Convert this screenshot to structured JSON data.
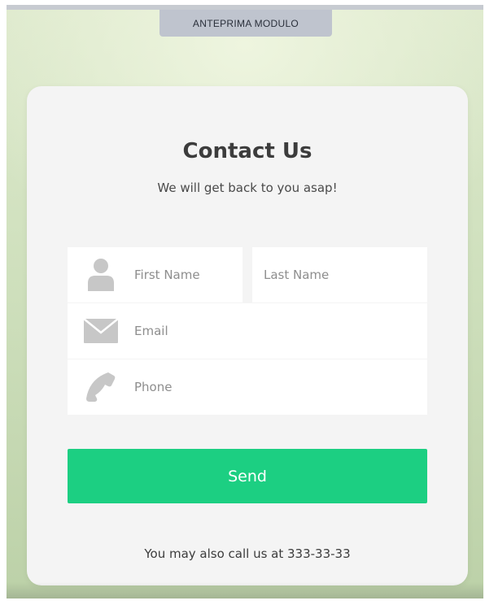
{
  "preview_tab": {
    "label": "ANTEPRIMA MODULO"
  },
  "card": {
    "title": "Contact Us",
    "subtitle": "We will get back to you asap!"
  },
  "form": {
    "first_name": {
      "placeholder": "First Name",
      "icon": "person-icon"
    },
    "last_name": {
      "placeholder": "Last Name"
    },
    "email": {
      "placeholder": "Email",
      "icon": "envelope-icon"
    },
    "phone": {
      "placeholder": "Phone",
      "icon": "phone-icon"
    }
  },
  "send_button": {
    "label": "Send"
  },
  "footer": {
    "note": "You may also call us at 333-33-33"
  },
  "colors": {
    "accent": "#1ccf82",
    "card_background": "#f4f4f4",
    "icon_gray": "#c7c7c7",
    "tab_background": "#bfc4ce"
  }
}
